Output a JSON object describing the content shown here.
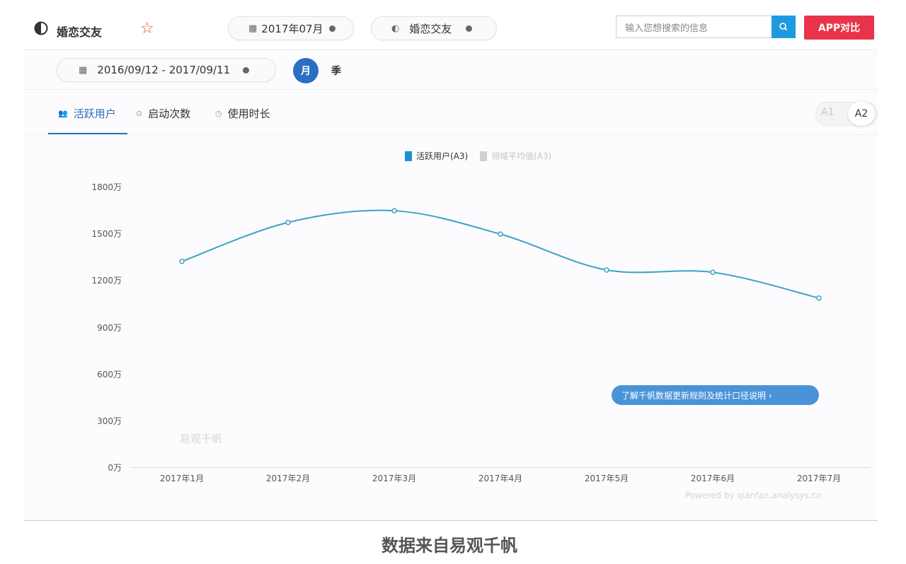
{
  "header": {
    "app_name": "婚恋交友",
    "month_filter": "2017年07月",
    "category_filter": "婚恋交友",
    "search_placeholder": "输入您想搜索的信息",
    "compare_button": "APP对比"
  },
  "filters": {
    "date_range": "2016/09/12 - 2017/09/11",
    "granularity_month": "月",
    "granularity_season": "季"
  },
  "tabs": [
    {
      "label": "活跃用户",
      "active": true
    },
    {
      "label": "启动次数",
      "active": false
    },
    {
      "label": "使用时长",
      "active": false
    }
  ],
  "toggle": {
    "a1": "A1",
    "a2": "A2"
  },
  "chart_data": {
    "type": "line",
    "legend": [
      "活跃用户(A3)",
      "领域平均值(A3)"
    ],
    "categories": [
      "2017年1月",
      "2017年2月",
      "2017年3月",
      "2017年4月",
      "2017年5月",
      "2017年6月",
      "2017年7月"
    ],
    "series": [
      {
        "name": "活跃用户(A3)",
        "values": [
          1320,
          1570,
          1645,
          1495,
          1265,
          1250,
          1085
        ]
      }
    ],
    "y_ticks": [
      "1800万",
      "1500万",
      "1200万",
      "900万",
      "600万",
      "300万",
      "0万"
    ],
    "ylim": [
      0,
      1800
    ],
    "color": "#3da1c7"
  },
  "note_link": "了解千帆数据更新规则及统计口径说明 ›",
  "watermark": "易观千帆",
  "powered_by": "Powered by qianfan.analysys.cn",
  "caption": "数据来自易观千帆"
}
